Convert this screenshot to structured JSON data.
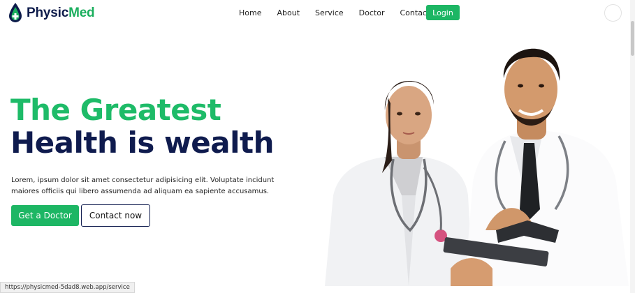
{
  "brand": {
    "part1": "Physic",
    "part2": "Med",
    "colors": {
      "dark": "#0d1b4b",
      "green": "#1aae5d"
    }
  },
  "nav": {
    "items": [
      {
        "label": "Home"
      },
      {
        "label": "About"
      },
      {
        "label": "Service"
      },
      {
        "label": "Doctor"
      },
      {
        "label": "Contact"
      }
    ],
    "login_label": "Login"
  },
  "hero": {
    "title_line1": "The Greatest",
    "title_line2": "Health is wealth",
    "description": "Lorem, ipsum dolor sit amet consectetur adipisicing elit. Voluptate incidunt maiores officiis qui libero assumenda ad aliquam ea sapiente accusamus.",
    "primary_button": "Get a Doctor",
    "secondary_button": "Contact now",
    "image_subject": "two-doctors-with-stethoscopes",
    "accent_color": "#1ebb68",
    "heading_color": "#0f1b4e"
  },
  "status_bar": {
    "url": "https://physicmed-5dad8.web.app/service"
  }
}
